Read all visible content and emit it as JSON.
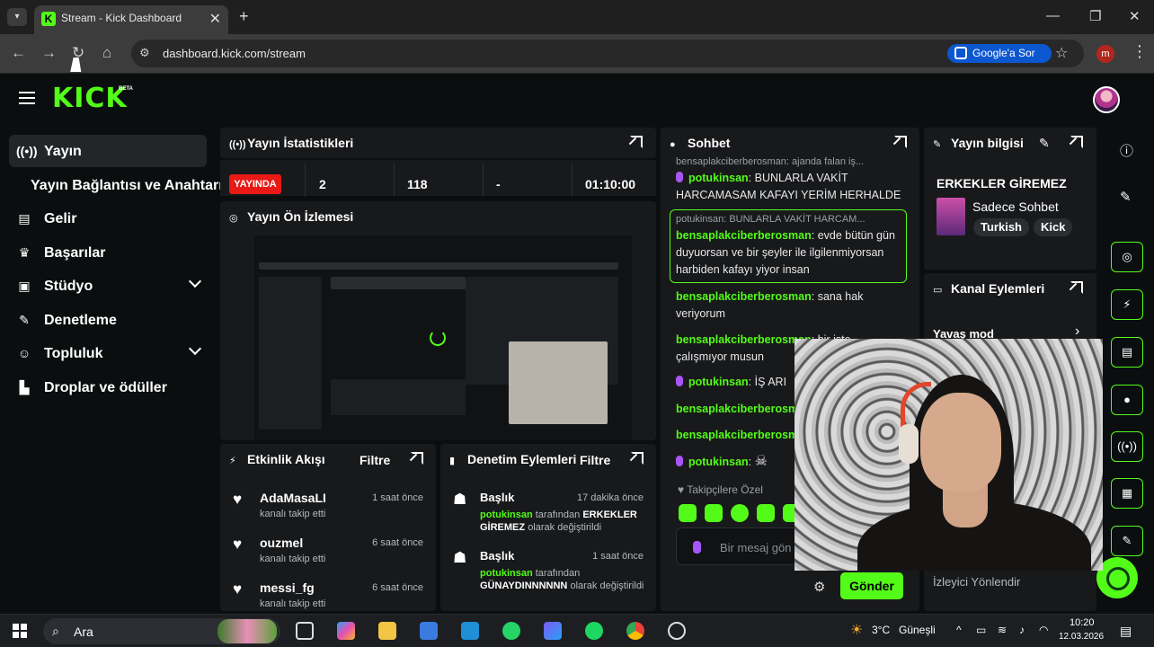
{
  "browser": {
    "tab_title": "Stream - Kick Dashboard",
    "tab_close": "✕",
    "new_tab": "+",
    "url": "dashboard.kick.com/stream",
    "ask_google": "Google'a Sor",
    "profile_letter": "m"
  },
  "header": {
    "logo": "KICK",
    "beta": "BETA"
  },
  "sidebar": {
    "items": [
      {
        "label": "Yayın",
        "icon": "broadcast-icon"
      },
      {
        "label": "Gelir",
        "icon": "chart-icon"
      },
      {
        "label": "Başarılar",
        "icon": "trophy-icon"
      },
      {
        "label": "Stüdyo",
        "icon": "studio-icon"
      },
      {
        "label": "Denetleme",
        "icon": "wrench-icon"
      },
      {
        "label": "Topluluk",
        "icon": "people-icon"
      },
      {
        "label": "Droplar ve ödüller",
        "icon": "drops-icon"
      }
    ],
    "sub_item": "Yayın Bağlantısı ve Anahtarı"
  },
  "stats": {
    "title": "Yayın İstatistikleri",
    "live_badge": "YAYINDA",
    "viewers": "2",
    "followers": "118",
    "subs": "-",
    "duration": "01:10:00"
  },
  "preview": {
    "title": "Yayın Ön İzlemesi"
  },
  "activity": {
    "title": "Etkinlik Akışı",
    "filter": "Filtre",
    "items": [
      {
        "user": "AdaMasaLI",
        "time": "1 saat önce",
        "desc": "kanalı takip etti"
      },
      {
        "user": "ouzmel",
        "time": "6 saat önce",
        "desc": "kanalı takip etti"
      },
      {
        "user": "messi_fg",
        "time": "6 saat önce",
        "desc": "kanalı takip etti"
      }
    ]
  },
  "modlog": {
    "title": "Denetim Eylemleri",
    "filter": "Filtre",
    "items": [
      {
        "title": "Başlık",
        "time": "17 dakika önce",
        "user": "potukinsan",
        "mid": "tarafından",
        "value": "ERKEKLER GİREMEZ",
        "end": "olarak değiştirildi"
      },
      {
        "title": "Başlık",
        "time": "1 saat önce",
        "user": "potukinsan",
        "mid": "tarafından",
        "value": "GÜNAYDINNNNNN",
        "end": "olarak değiştirildi"
      }
    ]
  },
  "chat": {
    "title": "Sohbet",
    "messages": [
      {
        "reply": "bensaplakciberberosman: ajanda falan iş...",
        "user": "potukinsan",
        "text": "BUNLARLA VAKİT HARCAMASAM KAFAYI YERİM HERHALDE"
      },
      {
        "reply": "potukinsan: BUNLARLA VAKİT HARCAM...",
        "user": "bensaplakciberberosman",
        "text": "evde bütün gün duyuorsan ve bir şeyler ile ilgilenmiyorsan harbiden kafayı yiyor insan"
      },
      {
        "user": "bensaplakciberberosman",
        "text": "sana hak veriyorum"
      },
      {
        "user": "bensaplakciberberosman",
        "text": "bir iste çalışmıyor musun"
      },
      {
        "user": "potukinsan",
        "text": "İŞ ARI"
      },
      {
        "user": "bensaplakciberberosman",
        "text": ""
      },
      {
        "user": "bensaplakciberberosman",
        "text": ""
      },
      {
        "user": "potukinsan",
        "text": ""
      }
    ],
    "emotes_title": "Takipçilere Özel",
    "input_placeholder": "Bir mesaj gön",
    "send": "Gönder"
  },
  "info": {
    "title": "Yayın bilgisi",
    "stream_title": "ERKEKLER GİREMEZ",
    "category": "Sadece Sohbet",
    "tags": [
      "Turkish",
      "Kick"
    ]
  },
  "channel_actions": {
    "title": "Kanal Eylemleri",
    "slow_mode": "Yavaş mod",
    "viewer_redirect": "İzleyici Yönlendir"
  },
  "taskbar": {
    "search": "Ara",
    "weather": "3°C",
    "weather_desc": "Güneşli",
    "time": "10:20",
    "date": "12.03.2026"
  },
  "colors": {
    "brand": "#53fc18",
    "live": "#e91916",
    "panel": "#18191b"
  }
}
